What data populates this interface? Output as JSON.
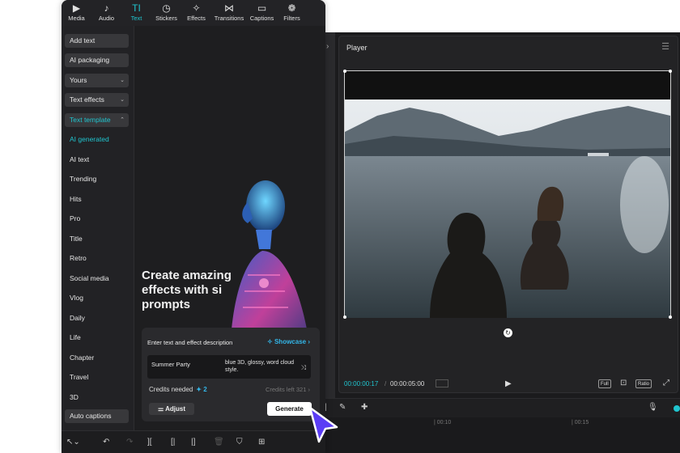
{
  "top_tabs": [
    {
      "label": "Media",
      "icon": "media-icon",
      "glyph": "▶"
    },
    {
      "label": "Audio",
      "icon": "audio-icon",
      "glyph": "♪"
    },
    {
      "label": "Text",
      "icon": "text-icon",
      "glyph": "TI"
    },
    {
      "label": "Stickers",
      "icon": "stickers-icon",
      "glyph": "◷"
    },
    {
      "label": "Effects",
      "icon": "effects-icon",
      "glyph": "✧"
    },
    {
      "label": "Transitions",
      "icon": "transitions-icon",
      "glyph": "⋈"
    },
    {
      "label": "Captions",
      "icon": "captions-icon",
      "glyph": "▭"
    },
    {
      "label": "Filters",
      "icon": "filters-icon",
      "glyph": "❁"
    }
  ],
  "sidebar": {
    "add_text": "Add text",
    "ai_packaging": "AI packaging",
    "yours": "Yours",
    "text_effects": "Text effects",
    "text_template": "Text template",
    "items": [
      "AI generated",
      "AI text",
      "Trending",
      "Hits",
      "Pro",
      "Title",
      "Retro",
      "Social media",
      "Vlog",
      "Daily",
      "Life",
      "Chapter",
      "Travel",
      "3D"
    ],
    "auto_captions": "Auto captions"
  },
  "hero": {
    "line1": "Create amazing",
    "line2": "effects with si",
    "line3": "prompts"
  },
  "generator": {
    "label": "Enter text and effect description",
    "showcase": "Showcase",
    "text_value": "Summer Party",
    "description_value": "blue 3D, glossy, word cloud style.",
    "credits_label": "Credits needed",
    "credits_value": "2",
    "credits_left": "Credits left  321",
    "adjust_label": "Adjust",
    "generate_label": "Generate"
  },
  "player": {
    "title": "Player",
    "current_time": "00:00:00:17",
    "separator": "/",
    "duration": "00:00:05:00",
    "full_label": "Full",
    "ratio_label": "Ratio"
  },
  "timeline": {
    "marks": [
      "| 00:10",
      "| 00:15"
    ]
  },
  "colors": {
    "accent": "#20c5cf",
    "showcase": "#33b6e8",
    "cursor": "#5b3df5"
  }
}
